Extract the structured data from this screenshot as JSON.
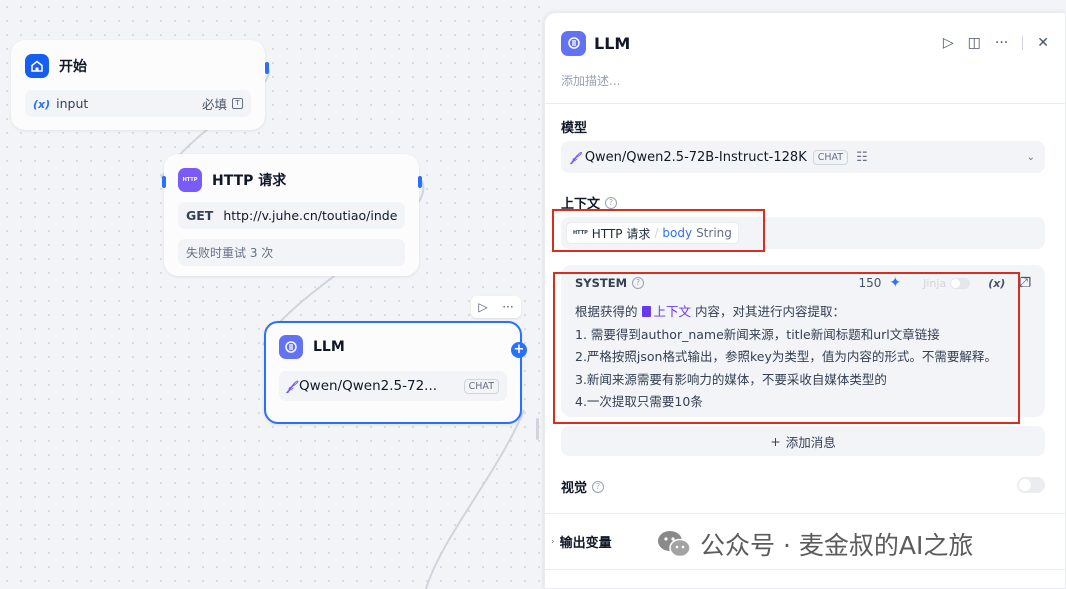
{
  "canvas": {
    "start_node": {
      "title": "开始",
      "var_icon": "(x)",
      "var_name": "input",
      "required_label": "必填"
    },
    "http_node": {
      "title": "HTTP 请求",
      "icon_text": "HTTP",
      "method": "GET",
      "url": "http://v.juhe.cn/toutiao/index",
      "retry_label": "失败时重试 3 次"
    },
    "llm_node": {
      "title": "LLM",
      "model": "Qwen/Qwen2.5-72...",
      "model_badge": "CHAT",
      "selected": true
    }
  },
  "panel": {
    "title": "LLM",
    "description_placeholder": "添加描述...",
    "model_section": {
      "label": "模型",
      "model": "Qwen/Qwen2.5-72B-Instruct-128K",
      "badge": "CHAT"
    },
    "context_section": {
      "label": "上下文",
      "var": {
        "node_icon": "HTTP",
        "node_name": "HTTP 请求",
        "var_name": "body",
        "var_type": "String"
      }
    },
    "system_prompt": {
      "label": "SYSTEM",
      "char_count": "150",
      "jinja_label": "Jinja",
      "var_insert_label": "(x)",
      "line1_prefix": "根据获得的",
      "line1_context": "上下文",
      "line1_suffix": "内容，对其进行内容提取：",
      "lines": [
        "1. 需要得到author_name新闻来源，title新闻标题和url文章链接",
        "2.严格按照json格式输出，参照key为类型，值为内容的形式。不需要解释。",
        "3.新闻来源需要有影响力的媒体，不要采收自媒体类型的",
        "4.一次提取只需要10条"
      ]
    },
    "add_message_label": "添加消息",
    "vision_section": {
      "label": "视觉",
      "enabled": false
    },
    "output_section": {
      "label": "输出变量"
    }
  },
  "watermark": {
    "text": "公众号 · 麦金叔的AI之旅"
  },
  "colors": {
    "accent": "#2970ff",
    "start_icon": "#155eef",
    "http_icon": "#7a5af8",
    "llm_icon": "#6172f3",
    "highlight": "#d92d20"
  }
}
